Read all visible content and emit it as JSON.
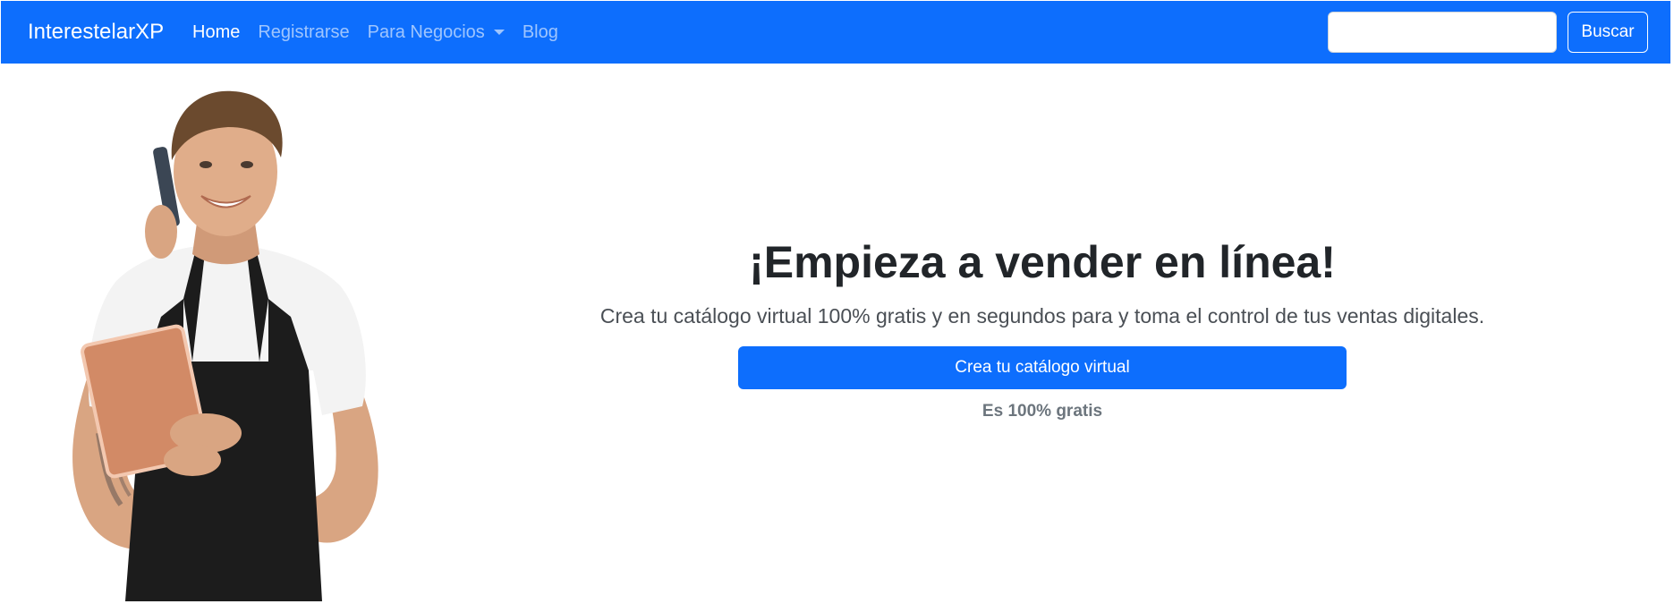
{
  "navbar": {
    "brand": "InterestelarXP",
    "links": [
      {
        "label": "Home",
        "active": true
      },
      {
        "label": "Registrarse",
        "active": false
      },
      {
        "label": "Para Negocios",
        "active": false,
        "dropdown": true
      },
      {
        "label": "Blog",
        "active": false
      }
    ],
    "search": {
      "value": "",
      "placeholder": "",
      "button_label": "Buscar"
    },
    "color": "#0d6efd"
  },
  "hero": {
    "image_icon": "smiling-vendor-with-phone-and-tablet",
    "title": "¡Empieza a vender en línea!",
    "subtitle": "Crea tu catálogo virtual 100% gratis y en segundos para y toma el control de tus ventas digitales.",
    "cta_label": "Crea tu catálogo virtual",
    "cta_note": "Es 100% gratis"
  }
}
